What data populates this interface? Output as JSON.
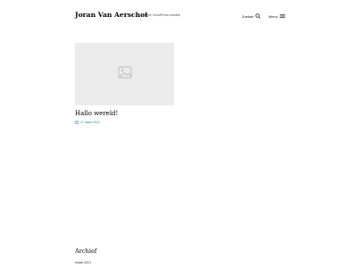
{
  "header": {
    "site_title": "Joran Van Aerschot",
    "tagline": "En nog een WordPress website",
    "search_label": "Zoeken",
    "menu_label": "Menu"
  },
  "post": {
    "title": "Hallo wereld!",
    "date": "27 maart 2021",
    "thumbnail_icon": "image-placeholder-icon"
  },
  "widget": {
    "title": "Archief",
    "items": [
      "maart 2021"
    ]
  },
  "colors": {
    "accent": "#2a8a96",
    "placeholder_bg": "#ececec"
  }
}
